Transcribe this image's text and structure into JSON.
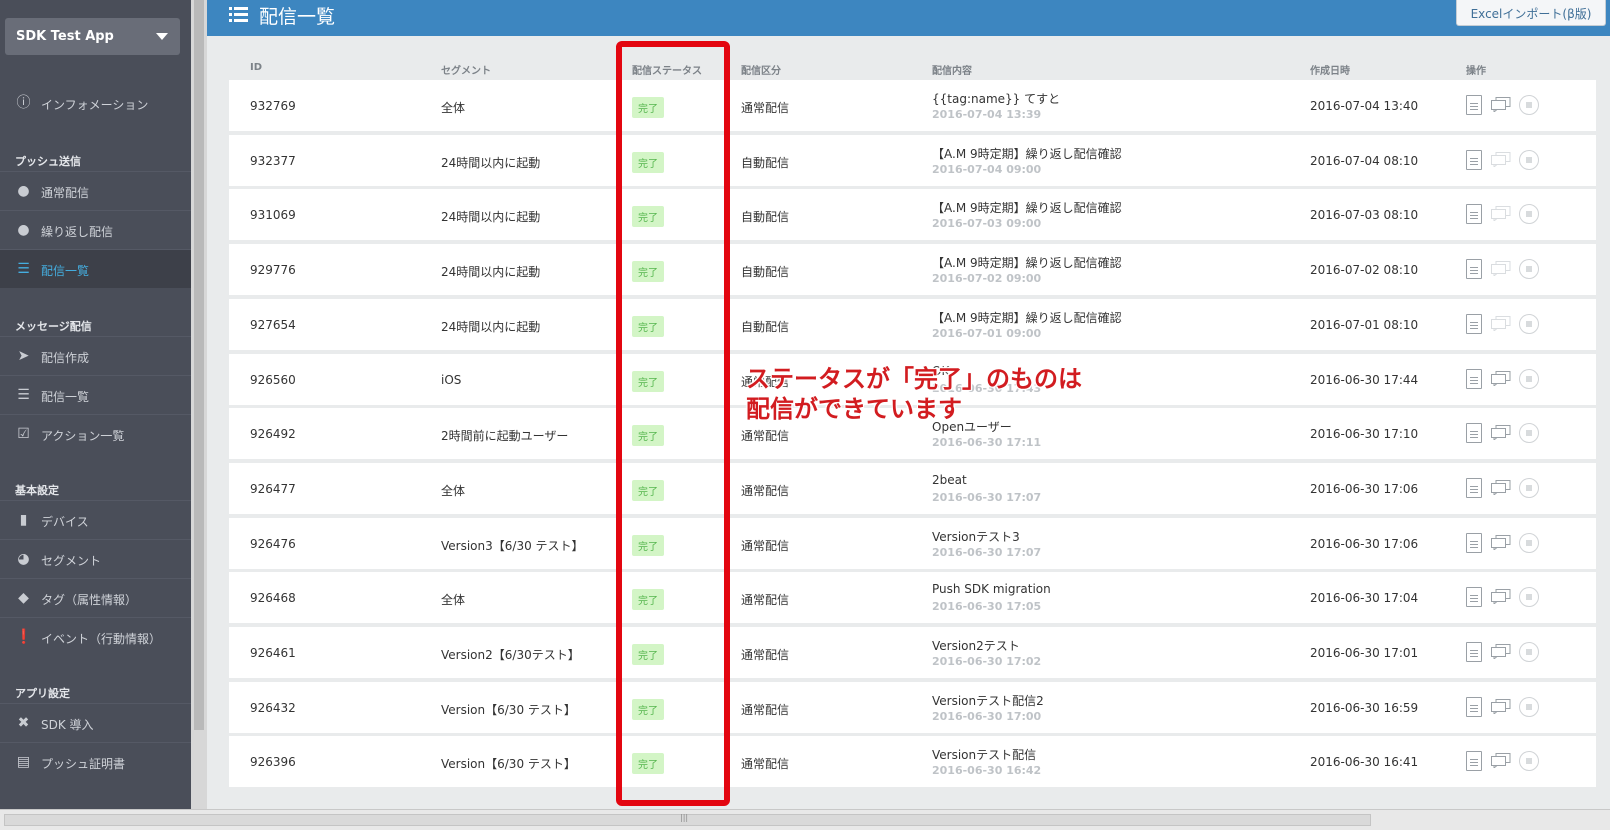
{
  "app": {
    "name": "SDK Test App"
  },
  "sidebar": {
    "info": "インフォメーション",
    "sections": {
      "push": "プッシュ送信",
      "message": "メッセージ配信",
      "basic": "基本設定",
      "app": "アプリ設定"
    },
    "push_items": [
      {
        "label": "通常配信",
        "icon": "bubble-icon"
      },
      {
        "label": "繰り返し配信",
        "icon": "repeat-bubble-icon"
      },
      {
        "label": "配信一覧",
        "icon": "list-icon",
        "active": true
      }
    ],
    "message_items": [
      {
        "label": "配信作成",
        "icon": "paper-plane-icon"
      },
      {
        "label": "配信一覧",
        "icon": "list-icon"
      },
      {
        "label": "アクション一覧",
        "icon": "checkbox-icon"
      }
    ],
    "basic_items": [
      {
        "label": "デバイス",
        "icon": "phone-icon"
      },
      {
        "label": "セグメント",
        "icon": "pie-chart-icon"
      },
      {
        "label": "タグ（属性情報）",
        "icon": "tag-icon"
      },
      {
        "label": "イベント（行動情報）",
        "icon": "exclamation-icon"
      }
    ],
    "app_items": [
      {
        "label": "SDK 導入",
        "icon": "tools-icon"
      },
      {
        "label": "プッシュ証明書",
        "icon": "certificate-icon"
      }
    ]
  },
  "header": {
    "title": "配信一覧",
    "excel_button": "Excelインポート(β版)"
  },
  "table": {
    "columns": {
      "id": "ID",
      "segment": "セグメント",
      "status": "配信ステータス",
      "kind": "配信区分",
      "content": "配信内容",
      "created": "作成日時",
      "ops": "操作"
    },
    "rows": [
      {
        "id": "932769",
        "segment": "全体",
        "status": "完了",
        "kind": "通常配信",
        "title": "{{tag:name}} てすと",
        "date": "2016-07-04 13:39",
        "created": "2016-07-04 13:40"
      },
      {
        "id": "932377",
        "segment": "24時間以内に起動",
        "status": "完了",
        "kind": "自動配信",
        "title": "【A.M 9時定期】繰り返し配信確認",
        "date": "2016-07-04 09:00",
        "created": "2016-07-04 08:10"
      },
      {
        "id": "931069",
        "segment": "24時間以内に起動",
        "status": "完了",
        "kind": "自動配信",
        "title": "【A.M 9時定期】繰り返し配信確認",
        "date": "2016-07-03 09:00",
        "created": "2016-07-03 08:10"
      },
      {
        "id": "929776",
        "segment": "24時間以内に起動",
        "status": "完了",
        "kind": "自動配信",
        "title": "【A.M 9時定期】繰り返し配信確認",
        "date": "2016-07-02 09:00",
        "created": "2016-07-02 08:10"
      },
      {
        "id": "927654",
        "segment": "24時間以内に起動",
        "status": "完了",
        "kind": "自動配信",
        "title": "【A.M 9時定期】繰り返し配信確認",
        "date": "2016-07-01 09:00",
        "created": "2016-07-01 08:10"
      },
      {
        "id": "926560",
        "segment": "iOS",
        "status": "完了",
        "kind": "通常配信",
        "title": "OK",
        "date": "2016-06-30 17:43",
        "created": "2016-06-30 17:44"
      },
      {
        "id": "926492",
        "segment": "2時間前に起動ユーザー",
        "status": "完了",
        "kind": "通常配信",
        "title": "Openユーザー",
        "date": "2016-06-30 17:11",
        "created": "2016-06-30 17:10"
      },
      {
        "id": "926477",
        "segment": "全体",
        "status": "完了",
        "kind": "通常配信",
        "title": "2beat",
        "date": "2016-06-30 17:07",
        "created": "2016-06-30 17:06"
      },
      {
        "id": "926476",
        "segment": "Version3【6/30 テスト】",
        "status": "完了",
        "kind": "通常配信",
        "title": "Versionテスト3",
        "date": "2016-06-30 17:07",
        "created": "2016-06-30 17:06"
      },
      {
        "id": "926468",
        "segment": "全体",
        "status": "完了",
        "kind": "通常配信",
        "title": "Push SDK migration",
        "date": "2016-06-30 17:05",
        "created": "2016-06-30 17:04"
      },
      {
        "id": "926461",
        "segment": "Version2【6/30テスト】",
        "status": "完了",
        "kind": "通常配信",
        "title": "Version2テスト",
        "date": "2016-06-30 17:02",
        "created": "2016-06-30 17:01"
      },
      {
        "id": "926432",
        "segment": "Version【6/30 テスト】",
        "status": "完了",
        "kind": "通常配信",
        "title": "Versionテスト配信2",
        "date": "2016-06-30 17:00",
        "created": "2016-06-30 16:59"
      },
      {
        "id": "926396",
        "segment": "Version【6/30 テスト】",
        "status": "完了",
        "kind": "通常配信",
        "title": "Versionテスト配信",
        "date": "2016-06-30 16:42",
        "created": "2016-06-30 16:41"
      }
    ]
  },
  "annotation": {
    "line1": "ステータスが「完了」のものは",
    "line2": "配信ができています"
  },
  "colors": {
    "sidebar_bg": "#4a4e59",
    "header_bg": "#3d86c0",
    "active_accent": "#45aee0",
    "status_badge_bg": "#d3f5c6",
    "status_badge_text": "#55b64d",
    "annotation_red": "#e30610"
  }
}
